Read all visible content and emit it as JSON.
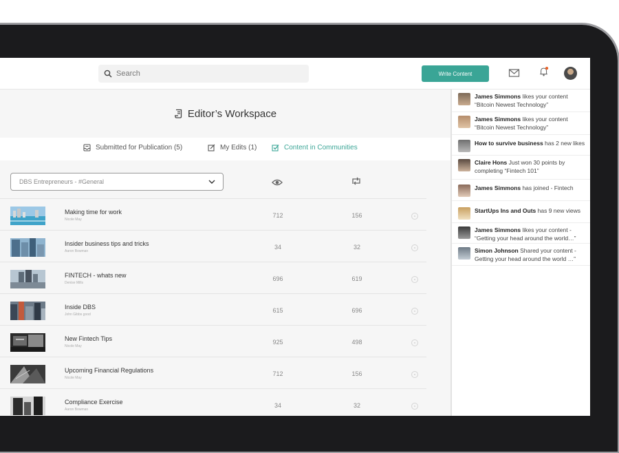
{
  "topbar": {
    "search_placeholder": "Search",
    "write_button": "Write Content",
    "icons": [
      "search-icon",
      "mail-icon",
      "bell-icon",
      "user-avatar"
    ],
    "accent_color": "#3aa596",
    "notification_dot_color": "#e8632a"
  },
  "workspace": {
    "title": "Editor’s Workspace",
    "tabs": [
      {
        "label": "Submitted for Publication (5)",
        "icon": "inbox-icon",
        "active": false
      },
      {
        "label": "My Edits (1)",
        "icon": "edit-icon",
        "active": false
      },
      {
        "label": "Content in Communities",
        "icon": "checkbox-icon",
        "active": true
      }
    ],
    "filter_value": "DBS Entrepreneurs - #General",
    "column_icons": [
      "eye-icon",
      "repost-icon"
    ]
  },
  "rows": [
    {
      "title": "Making time for work",
      "author": "Nicole May",
      "views": "712",
      "shares": "156",
      "thumb": "pool"
    },
    {
      "title": "Insider business tips and tricks",
      "author": "Aaron Bowman",
      "views": "34",
      "shares": "32",
      "thumb": "towers"
    },
    {
      "title": "FINTECH - whats new",
      "author": "Denise Mills",
      "views": "696",
      "shares": "619",
      "thumb": "skyscraper"
    },
    {
      "title": "Inside DBS",
      "author": "John Gibbs good",
      "views": "615",
      "shares": "696",
      "thumb": "city"
    },
    {
      "title": "New Fintech Tips",
      "author": "Nicole May",
      "views": "925",
      "shares": "498",
      "thumb": "office"
    },
    {
      "title": "Upcoming Financial Regulations",
      "author": "Nicole May",
      "views": "712",
      "shares": "156",
      "thumb": "bw-building"
    },
    {
      "title": "Compliance Exercise",
      "author": "Aaron Bowman",
      "views": "34",
      "shares": "32",
      "thumb": "dark-tower"
    }
  ],
  "notifications": [
    {
      "name": "James Simmons",
      "text": " likes your content",
      "line2": "“Bitcoin Newest Technology”",
      "avatar": "person-1"
    },
    {
      "name": "James Simmons",
      "text": " likes your content",
      "line2": "“Bitcoin Newest Technology”",
      "avatar": "person-2"
    },
    {
      "name": "How to survive business",
      "text": " has 2 new likes",
      "line2": "",
      "avatar": "building-1"
    },
    {
      "name": "Claire Hons",
      "text": " Just won 30 points by",
      "line2": "completing “Fintech 101”",
      "avatar": "person-3"
    },
    {
      "name": "James Simmons",
      "text": " has joined - Fintech",
      "line2": "",
      "avatar": "person-4"
    },
    {
      "name": "StartUps Ins and Outs",
      "text": " has 9 new views",
      "line2": "",
      "avatar": "person-5"
    },
    {
      "name": "James Simmons",
      "text": " likes your content -",
      "line2": "“Getting your head around the world…”",
      "avatar": "person-6"
    },
    {
      "name": "Simon Johnson",
      "text": " Shared your content -",
      "line2": "Getting your head around the world  …”",
      "avatar": "building-2"
    }
  ]
}
